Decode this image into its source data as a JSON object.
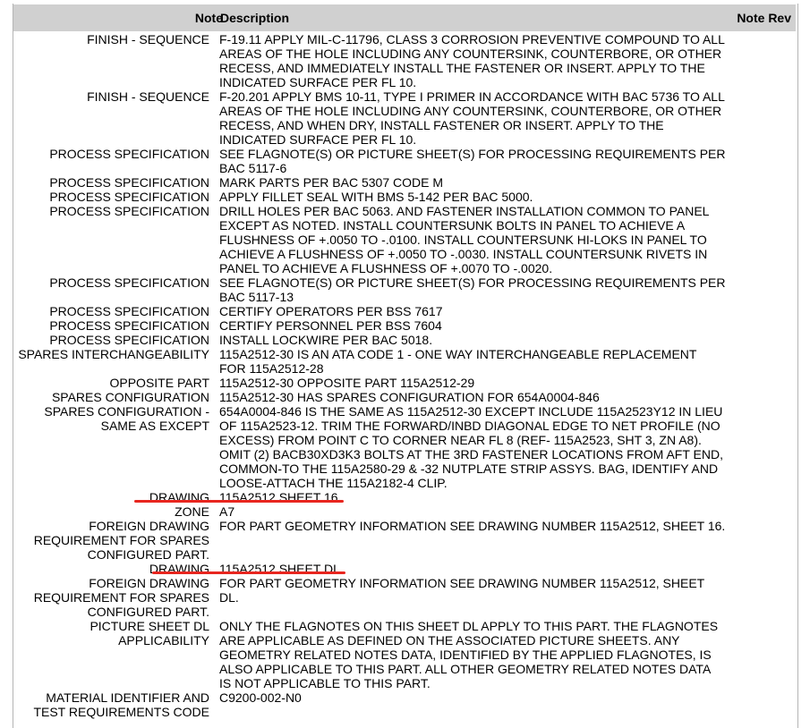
{
  "columns": {
    "note": "Note",
    "description": "Description",
    "note_rev": "Note Rev"
  },
  "rows": [
    {
      "note": "FINISH - SEQUENCE",
      "description": "F-19.11 APPLY MIL-C-11796, CLASS 3 CORROSION PREVENTIVE COMPOUND TO ALL\nAREAS OF THE HOLE INCLUDING ANY COUNTERSINK, COUNTERBORE, OR OTHER\nRECESS, AND IMMEDIATELY INSTALL THE FASTENER OR INSERT. APPLY TO THE\nINDICATED SURFACE PER FL 10."
    },
    {
      "note": "FINISH - SEQUENCE",
      "description": "F-20.201 APPLY BMS 10-11, TYPE I PRIMER IN ACCORDANCE WITH BAC 5736 TO ALL\nAREAS OF THE HOLE INCLUDING ANY COUNTERSINK, COUNTERBORE, OR OTHER\nRECESS, AND WHEN DRY, INSTALL FASTENER OR INSERT. APPLY TO THE\nINDICATED SURFACE PER FL 10."
    },
    {
      "note": "PROCESS SPECIFICATION",
      "description": "SEE FLAGNOTE(S) OR PICTURE SHEET(S) FOR PROCESSING REQUIREMENTS PER\nBAC 5117-6"
    },
    {
      "note": "PROCESS SPECIFICATION",
      "description": "MARK PARTS PER BAC 5307 CODE M"
    },
    {
      "note": "PROCESS SPECIFICATION",
      "description": "APPLY FILLET SEAL WITH BMS 5-142 PER BAC 5000."
    },
    {
      "note": "PROCESS SPECIFICATION",
      "description": "DRILL HOLES PER BAC 5063. AND FASTENER INSTALLATION COMMON TO PANEL\nEXCEPT AS NOTED. INSTALL COUNTERSUNK BOLTS IN PANEL TO ACHIEVE A\nFLUSHNESS OF +.0050 TO -.0100. INSTALL COUNTERSUNK HI-LOKS IN PANEL TO\nACHIEVE A FLUSHNESS OF +.0050 TO -.0030. INSTALL COUNTERSUNK RIVETS IN\nPANEL TO ACHIEVE A FLUSHNESS OF +.0070 TO -.0020."
    },
    {
      "note": "PROCESS SPECIFICATION",
      "description": "SEE FLAGNOTE(S) OR PICTURE SHEET(S) FOR PROCESSING REQUIREMENTS PER\nBAC 5117-13"
    },
    {
      "note": "PROCESS SPECIFICATION",
      "description": "CERTIFY OPERATORS PER BSS 7617"
    },
    {
      "note": "PROCESS SPECIFICATION",
      "description": "CERTIFY PERSONNEL PER BSS 7604"
    },
    {
      "note": "PROCESS SPECIFICATION",
      "description": "INSTALL LOCKWIRE PER BAC 5018."
    },
    {
      "note": "SPARES INTERCHANGEABILITY",
      "description": "115A2512-30 IS AN ATA CODE 1 - ONE WAY INTERCHANGEABLE REPLACEMENT\nFOR 115A2512-28"
    },
    {
      "note": "OPPOSITE PART",
      "description": "115A2512-30 OPPOSITE PART 115A2512-29"
    },
    {
      "note": "SPARES CONFIGURATION",
      "description": "115A2512-30 HAS SPARES CONFIGURATION FOR 654A0004-846"
    },
    {
      "note": "SPARES CONFIGURATION -\nSAME AS EXCEPT",
      "description": "654A0004-846 IS THE SAME AS 115A2512-30 EXCEPT INCLUDE 115A2523Y12 IN LIEU\nOF 115A2523-12. TRIM THE FORWARD/INBD DIAGONAL EDGE TO NET PROFILE (NO\nEXCESS) FROM POINT C TO CORNER NEAR FL 8 (REF- 115A2523, SHT 3, ZN A8).\nOMIT (2) BACB30XD3K3 BOLTS AT THE 3RD FASTENER LOCATIONS FROM AFT END,\nCOMMON-TO THE 115A2580-29 & -32 NUTPLATE STRIP ASSYS. BAG, IDENTIFY AND\nLOOSE-ATTACH THE 115A2182-4 CLIP."
    },
    {
      "note": "DRAWING",
      "description": "115A2512 SHEET 16"
    },
    {
      "note": "ZONE",
      "description": "A7"
    },
    {
      "note": "FOREIGN DRAWING\nREQUIREMENT FOR SPARES\nCONFIGURED PART.",
      "description": "FOR PART GEOMETRY INFORMATION SEE DRAWING NUMBER 115A2512, SHEET 16."
    },
    {
      "note": "DRAWING",
      "description": "115A2512 SHEET DL"
    },
    {
      "note": "FOREIGN DRAWING\nREQUIREMENT FOR SPARES\nCONFIGURED PART.",
      "description": "FOR PART GEOMETRY INFORMATION SEE DRAWING NUMBER 115A2512, SHEET\nDL."
    },
    {
      "note": "PICTURE SHEET DL\nAPPLICABILITY",
      "description": "ONLY THE FLAGNOTES ON THIS SHEET DL APPLY TO THIS PART. THE FLAGNOTES\nARE APPLICABLE AS DEFINED ON THE ASSOCIATED PICTURE SHEETS. ANY\nGEOMETRY RELATED NOTES DATA, IDENTIFIED BY THE APPLIED FLAGNOTES, IS\nALSO APPLICABLE TO THIS PART. ALL OTHER GEOMETRY RELATED NOTES DATA\nIS NOT APPLICABLE TO THIS PART."
    },
    {
      "note": "MATERIAL IDENTIFIER AND\nTEST REQUIREMENTS CODE",
      "description": "C9200-002-N0"
    }
  ],
  "highlight_color": "#e8261f"
}
